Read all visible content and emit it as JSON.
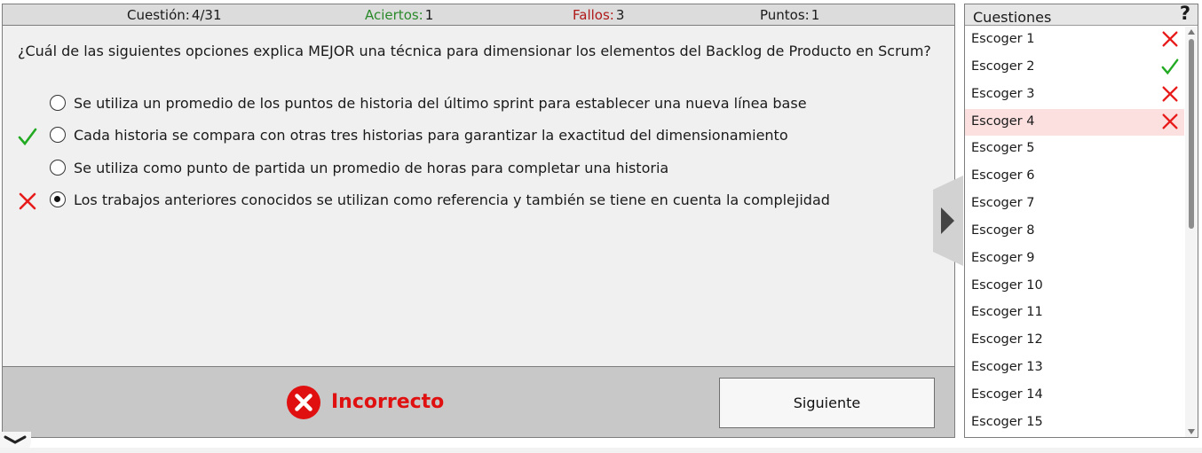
{
  "stats": {
    "question_label": "Cuestión:",
    "question_value": "4/31",
    "correct_label": "Aciertos:",
    "correct_value": "1",
    "errors_label": "Fallos:",
    "errors_value": "3",
    "points_label": "Puntos:",
    "points_value": "1"
  },
  "question": {
    "text": "¿Cuál de las siguientes opciones explica MEJOR una técnica para dimensionar los elementos del Backlog de Producto en Scrum?",
    "options": [
      {
        "label": "Se utiliza un promedio de los puntos de historia del último sprint para establecer una nueva línea base",
        "selected": false,
        "mark": ""
      },
      {
        "label": "Cada historia se compara con otras tres historias para garantizar la exactitud del dimensionamiento",
        "selected": false,
        "mark": "check-icon"
      },
      {
        "label": "Se utiliza como punto de partida un promedio de horas para completar una historia",
        "selected": false,
        "mark": ""
      },
      {
        "label": "Los trabajos anteriores conocidos se utilizan como referencia y también se tiene en cuenta la complejidad",
        "selected": true,
        "mark": "cross-icon"
      }
    ]
  },
  "result": {
    "text": "Incorrecto",
    "icon": "error-circle-icon",
    "color": "#e01010"
  },
  "next_button": "Siguiente",
  "list": {
    "title": "Cuestiones",
    "help": "?",
    "items": [
      {
        "label": "Escoger 1",
        "status": "wrong"
      },
      {
        "label": "Escoger 2",
        "status": "correct"
      },
      {
        "label": "Escoger 3",
        "status": "wrong"
      },
      {
        "label": "Escoger 4",
        "status": "wrong",
        "current": true
      },
      {
        "label": "Escoger 5",
        "status": ""
      },
      {
        "label": "Escoger 6",
        "status": ""
      },
      {
        "label": "Escoger 7",
        "status": ""
      },
      {
        "label": "Escoger 8",
        "status": ""
      },
      {
        "label": "Escoger 9",
        "status": ""
      },
      {
        "label": "Escoger 10",
        "status": ""
      },
      {
        "label": "Escoger 11",
        "status": ""
      },
      {
        "label": "Escoger 12",
        "status": ""
      },
      {
        "label": "Escoger 13",
        "status": ""
      },
      {
        "label": "Escoger 14",
        "status": ""
      },
      {
        "label": "Escoger 15",
        "status": ""
      }
    ]
  },
  "colors": {
    "correct": "#22aa22",
    "wrong": "#e81b1b",
    "current_row": "#fce0e0"
  }
}
